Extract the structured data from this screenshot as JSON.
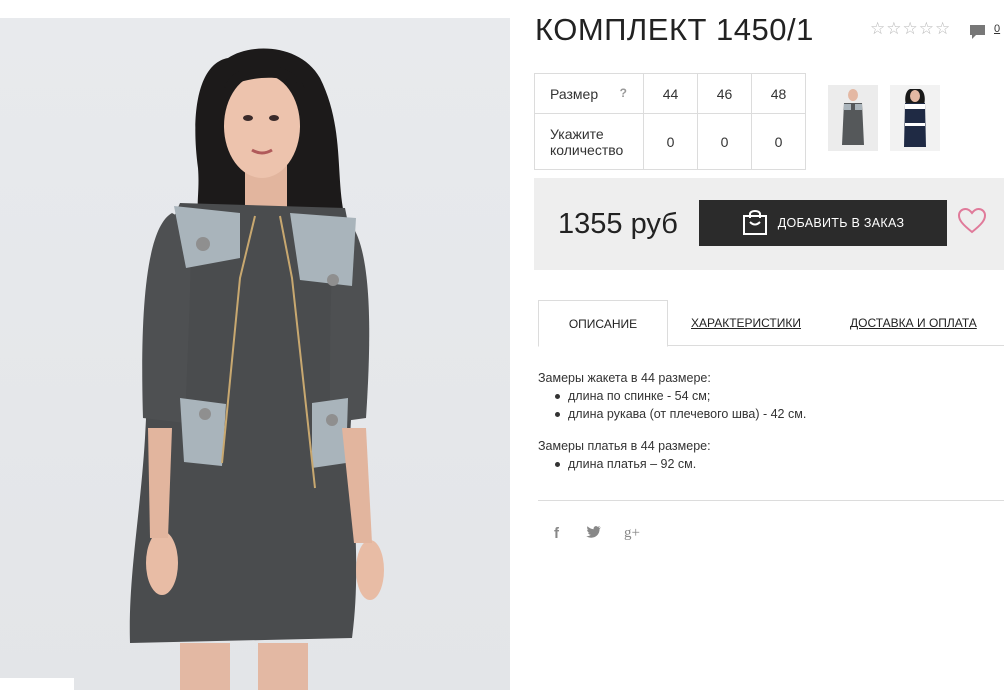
{
  "product": {
    "title": "КОМПЛЕКТ 1450/1",
    "rating_stars": 5,
    "comment_count": "0"
  },
  "size_table": {
    "size_label": "Размер",
    "help_glyph": "?",
    "sizes": [
      "44",
      "46",
      "48"
    ],
    "qty_label_line1": "Укажите",
    "qty_label_line2": "количество",
    "quantities": [
      "0",
      "0",
      "0"
    ]
  },
  "price": {
    "value": "1355 руб",
    "order_button": "ДОБАВИТЬ В ЗАКАЗ"
  },
  "tabs": [
    {
      "label": "ОПИСАНИЕ",
      "active": true
    },
    {
      "label": "ХАРАКТЕРИСТИКИ",
      "active": false
    },
    {
      "label": "ДОСТАВКА И ОПЛАТА",
      "active": false
    }
  ],
  "description": {
    "jacket_heading": "Замеры жакета в 44 размере:",
    "jacket_items": [
      "длина по спинке - 54 см;",
      "длина рукава (от плечевого шва) - 42 см."
    ],
    "dress_heading": "Замеры платья в 44 размере:",
    "dress_items": [
      "длина платья – 92 см."
    ]
  },
  "social": {
    "facebook": "f",
    "twitter": "t",
    "googleplus": "g+"
  },
  "colors": {
    "button_bg": "#2b2b2b",
    "heart": "#e07a9a",
    "price_box": "#eeeeee"
  }
}
